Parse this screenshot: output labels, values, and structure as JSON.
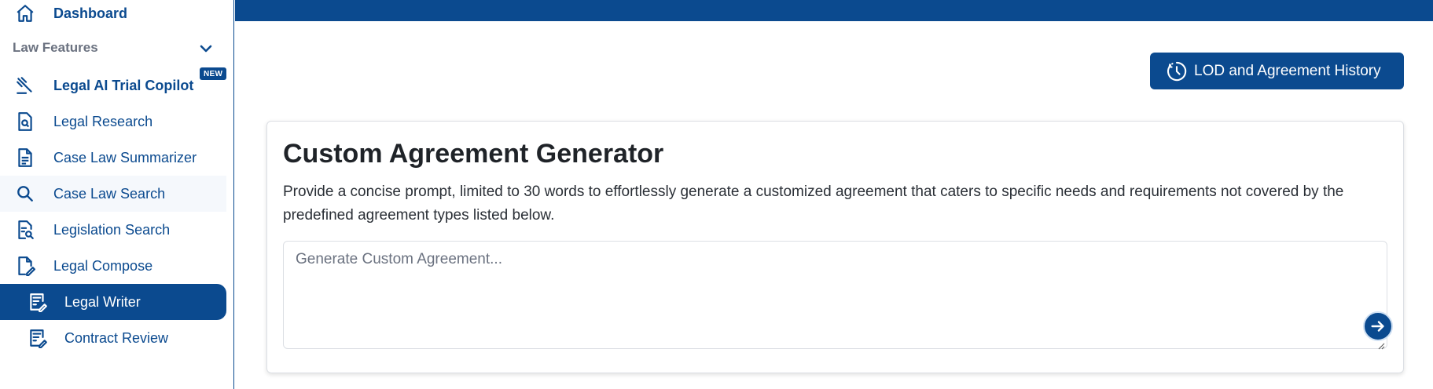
{
  "sidebar": {
    "dashboard_label": "Dashboard",
    "section_label": "Law Features",
    "new_badge": "NEW",
    "items": [
      {
        "label": "Legal AI Trial Copilot",
        "icon": "gavel-icon"
      },
      {
        "label": "Legal Research",
        "icon": "document-search-icon"
      },
      {
        "label": "Case Law Summarizer",
        "icon": "document-lines-icon"
      },
      {
        "label": "Case Law Search",
        "icon": "search-icon"
      },
      {
        "label": "Legislation Search",
        "icon": "document-magnify-icon"
      },
      {
        "label": "Legal Compose",
        "icon": "document-pen-icon"
      },
      {
        "label": "Legal Writer",
        "icon": "writer-icon"
      },
      {
        "label": "Contract Review",
        "icon": "contract-icon"
      }
    ]
  },
  "header": {
    "history_button_label": "LOD and Agreement History"
  },
  "generator": {
    "title": "Custom Agreement Generator",
    "description": "Provide a concise prompt, limited to 30 words to effortlessly generate a customized agreement that caters to specific needs and requirements not covered by the predefined agreement types listed below.",
    "input_placeholder": "Generate Custom Agreement...",
    "input_value": ""
  },
  "colors": {
    "brand": "#0b4a8f",
    "muted": "#6b7280",
    "border": "#dcdfe4"
  }
}
